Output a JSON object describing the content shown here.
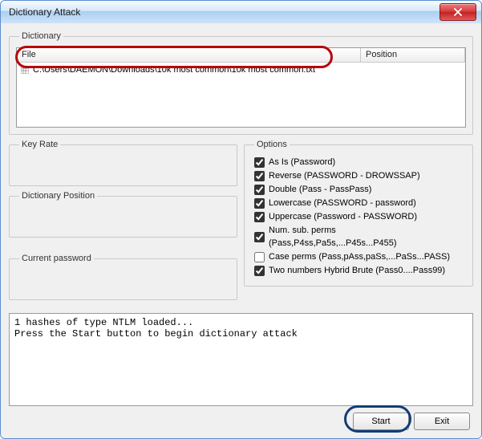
{
  "window": {
    "title": "Dictionary Attack"
  },
  "dictionary": {
    "legend": "Dictionary",
    "columns": {
      "file": "File",
      "position": "Position"
    },
    "rows": [
      {
        "icon": "grid-icon",
        "path": "C:\\Users\\DAEMON\\Downloads\\10k most common\\10k most common.txt",
        "position": ""
      }
    ]
  },
  "keyrate": {
    "legend": "Key Rate",
    "value": ""
  },
  "dictpos": {
    "legend": "Dictionary Position",
    "value": ""
  },
  "curpw": {
    "legend": "Current password",
    "value": ""
  },
  "options": {
    "legend": "Options",
    "items": [
      {
        "label": "As Is (Password)",
        "checked": true
      },
      {
        "label": "Reverse (PASSWORD - DROWSSAP)",
        "checked": true
      },
      {
        "label": "Double (Pass - PassPass)",
        "checked": true
      },
      {
        "label": "Lowercase (PASSWORD - password)",
        "checked": true
      },
      {
        "label": "Uppercase (Password - PASSWORD)",
        "checked": true
      },
      {
        "label": "Num. sub. perms (Pass,P4ss,Pa5s,...P45s...P455)",
        "checked": true
      },
      {
        "label": "Case perms (Pass,pAss,paSs,...PaSs...PASS)",
        "checked": false
      },
      {
        "label": "Two numbers Hybrid Brute (Pass0....Pass99)",
        "checked": true
      }
    ]
  },
  "log": {
    "lines": [
      "1 hashes of type NTLM loaded...",
      "Press the Start button to begin dictionary attack"
    ]
  },
  "buttons": {
    "start": "Start",
    "exit": "Exit"
  }
}
